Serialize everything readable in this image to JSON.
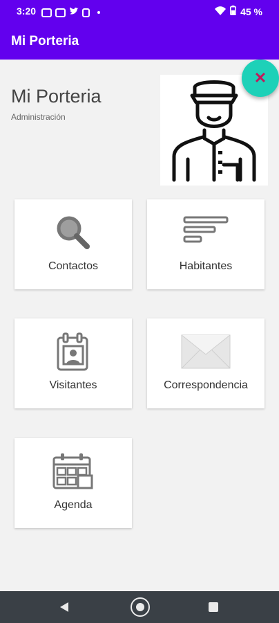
{
  "status_bar": {
    "time": "3:20",
    "left_icons": [
      "youtube-icon",
      "twitch-icon",
      "twitter-icon",
      "sim-icon"
    ],
    "battery": "45 %"
  },
  "app_bar": {
    "title": "Mi Porteria"
  },
  "header": {
    "title": "Mi Porteria",
    "subtitle": "Administración"
  },
  "fab": {
    "icon": "close-icon",
    "symbol": "✕"
  },
  "menu": {
    "items": [
      {
        "label": "Contactos",
        "icon": "search-icon"
      },
      {
        "label": "Habitantes",
        "icon": "list-icon"
      },
      {
        "label": "Visitantes",
        "icon": "visitor-badge-icon"
      },
      {
        "label": "Correspondencia",
        "icon": "envelope-icon"
      },
      {
        "label": "Agenda",
        "icon": "calendar-icon"
      }
    ]
  },
  "colors": {
    "primary": "#6200ee",
    "fab": "#1dd1b8",
    "fab_icon": "#c2185b",
    "nav_bar": "#3a4046"
  }
}
